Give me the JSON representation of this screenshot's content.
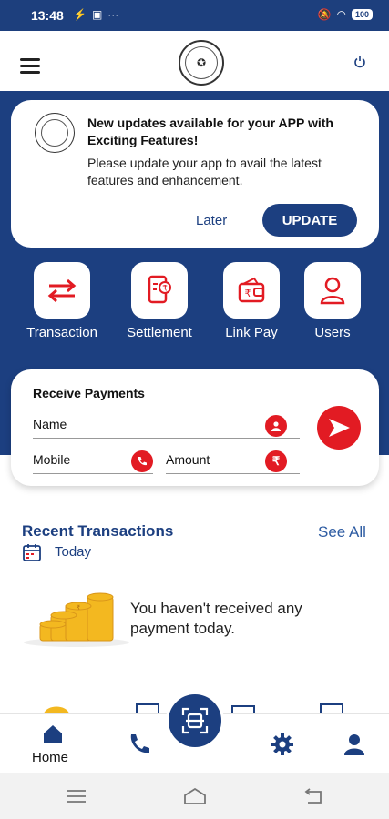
{
  "status_bar": {
    "time": "13:48",
    "battery": "100"
  },
  "update_card": {
    "title": "New updates available for your APP with Exciting Features!",
    "description": "Please update your app to avail the latest features and enhancement.",
    "later_label": "Later",
    "update_label": "UPDATE"
  },
  "quick_actions": [
    {
      "label": "Transaction",
      "icon": "transfer-arrows-icon"
    },
    {
      "label": "Settlement",
      "icon": "settlement-document-icon"
    },
    {
      "label": "Link Pay",
      "icon": "wallet-rupee-icon"
    },
    {
      "label": "Users",
      "icon": "user-icon"
    }
  ],
  "receive": {
    "title": "Receive Payments",
    "name_placeholder": "Name",
    "mobile_placeholder": "Mobile",
    "amount_placeholder": "Amount",
    "rupee_symbol": "₹"
  },
  "recent": {
    "title": "Recent Transactions",
    "see_all": "See All",
    "filter": "Today",
    "empty_message": "You haven't received any payment today."
  },
  "bottom_nav": {
    "home_label": "Home"
  },
  "colors": {
    "primary": "#1c3f80",
    "accent": "#e21b23",
    "coin": "#f3b820"
  }
}
